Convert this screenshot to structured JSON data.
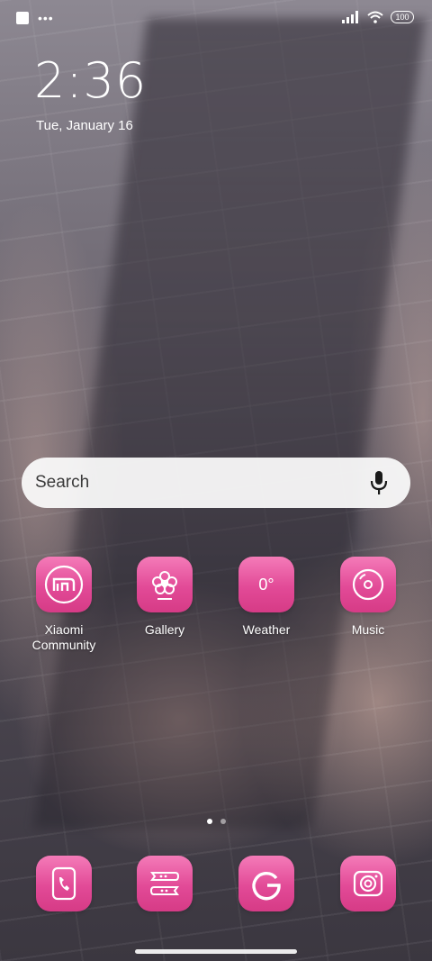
{
  "status_bar": {
    "battery": "100",
    "icons": [
      "notification-square-icon",
      "more-dots-icon",
      "signal-icon",
      "wifi-icon",
      "battery-icon"
    ]
  },
  "clock": {
    "time": "2:36",
    "date": "Tue, January 16"
  },
  "search": {
    "placeholder": "Search",
    "icon": "mic-icon"
  },
  "apps": [
    {
      "label": "Xiaomi Community",
      "icon": "mi-logo-icon"
    },
    {
      "label": "Gallery",
      "icon": "flower-icon"
    },
    {
      "label": "Weather",
      "icon": "temperature-icon",
      "value": "0°"
    },
    {
      "label": "Music",
      "icon": "disc-icon"
    }
  ],
  "page_indicator": {
    "pages": 2,
    "current": 1
  },
  "dock": [
    {
      "icon": "phone-icon"
    },
    {
      "icon": "messages-icon"
    },
    {
      "icon": "google-icon"
    },
    {
      "icon": "camera-icon"
    }
  ],
  "colors": {
    "icon_pink": "#e24a97",
    "search_bg": "#fafafa"
  }
}
